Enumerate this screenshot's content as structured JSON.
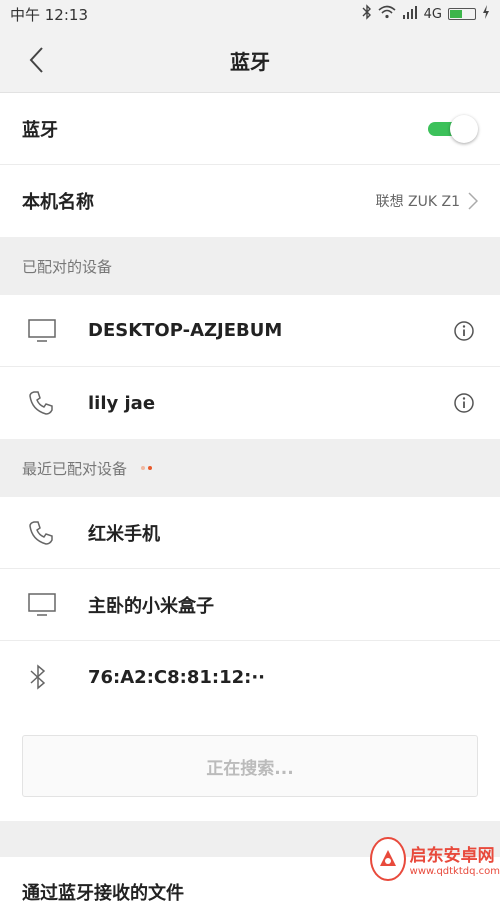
{
  "status_bar": {
    "time": "中午 12:13",
    "network": "4G"
  },
  "header": {
    "title": "蓝牙"
  },
  "settings": {
    "bluetooth_label": "蓝牙",
    "bluetooth_enabled": true,
    "device_name_label": "本机名称",
    "device_name_value": "联想 ZUK Z1"
  },
  "paired_section": {
    "title": "已配对的设备",
    "devices": [
      {
        "name": "DESKTOP-AZJEBUM",
        "icon": "monitor-icon"
      },
      {
        "name": "lily jae",
        "icon": "phone-icon"
      }
    ]
  },
  "recent_section": {
    "title": "最近已配对设备",
    "devices": [
      {
        "name": "红米手机",
        "icon": "phone-icon"
      },
      {
        "name": "主卧的小米盒子",
        "icon": "monitor-icon"
      },
      {
        "name": "76:A2:C8:81:12:··",
        "icon": "bluetooth-icon"
      }
    ]
  },
  "search": {
    "label": "正在搜索..."
  },
  "bottom": {
    "label": "通过蓝牙接收的文件"
  },
  "watermark": {
    "title": "启东安卓网",
    "url": "www.qdtktdq.com"
  },
  "colors": {
    "accent": "#3cc15a",
    "dot1": "#f0b8a0",
    "dot2": "#e85a2c",
    "watermark": "#e84a3c"
  }
}
